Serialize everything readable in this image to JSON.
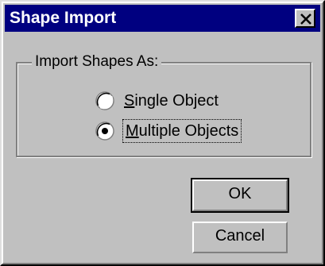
{
  "dialog": {
    "title": "Shape Import",
    "close_icon": "close-icon"
  },
  "group": {
    "legend": "Import Shapes As:",
    "options": [
      {
        "accel": "S",
        "rest": "ingle Object",
        "selected": false
      },
      {
        "accel": "M",
        "rest": "ultiple Objects",
        "selected": true
      }
    ]
  },
  "buttons": {
    "ok": "OK",
    "cancel": "Cancel"
  }
}
